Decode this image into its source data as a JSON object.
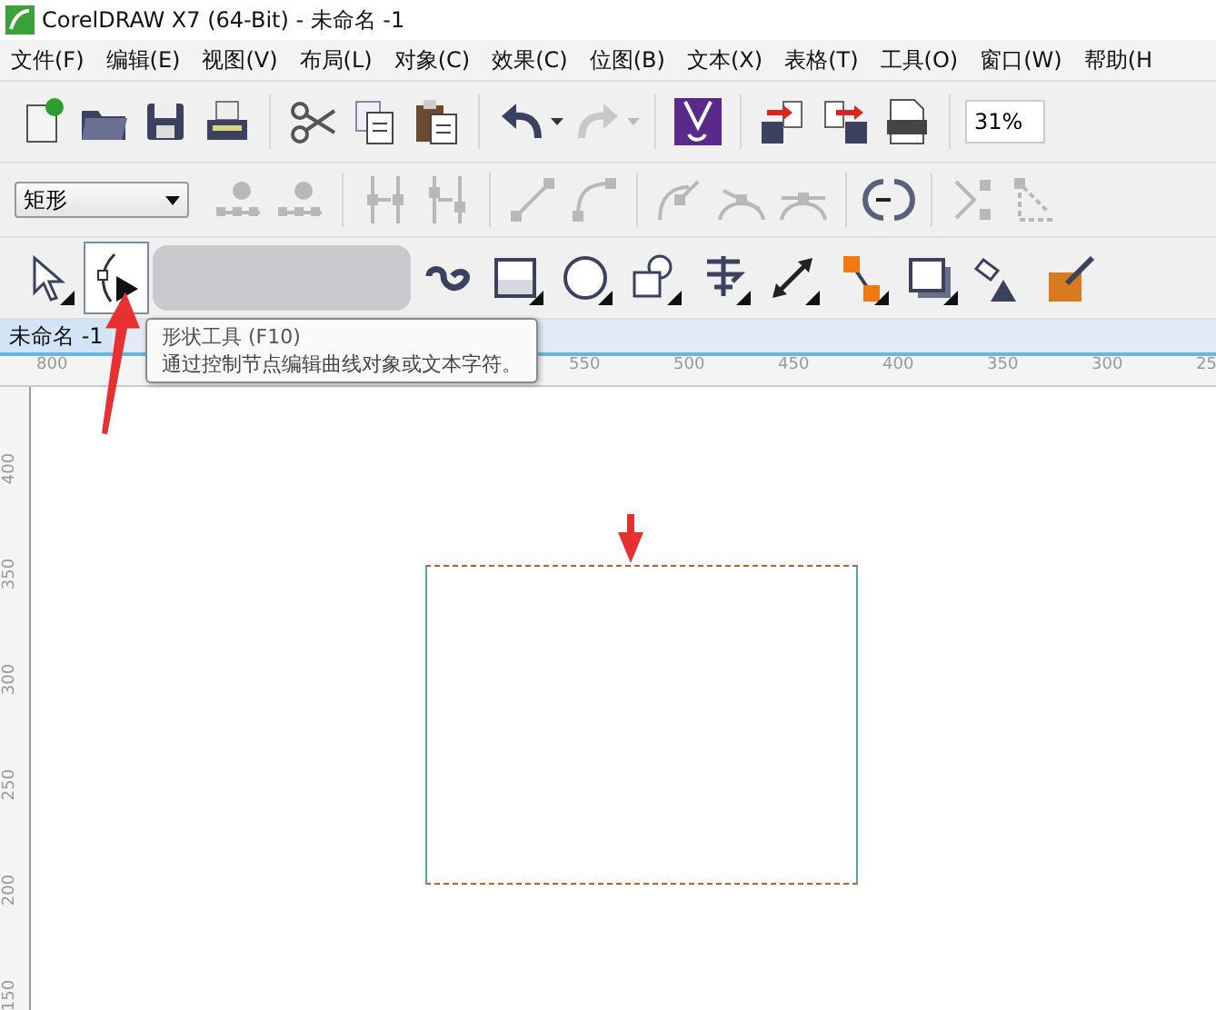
{
  "window": {
    "title": "CorelDRAW X7 (64-Bit) - 未命名 -1"
  },
  "menu": [
    {
      "label": "文件(F)"
    },
    {
      "label": "编辑(E)"
    },
    {
      "label": "视图(V)"
    },
    {
      "label": "布局(L)"
    },
    {
      "label": "对象(C)"
    },
    {
      "label": "效果(C)"
    },
    {
      "label": "位图(B)"
    },
    {
      "label": "文本(X)"
    },
    {
      "label": "表格(T)"
    },
    {
      "label": "工具(O)"
    },
    {
      "label": "窗口(W)"
    },
    {
      "label": "帮助(H"
    }
  ],
  "toolbar": {
    "zoom_value": "31%"
  },
  "property_bar": {
    "shape_select": "矩形"
  },
  "toolbox": {
    "tools": [
      {
        "kind": "pick",
        "selected": false
      },
      {
        "kind": "shape",
        "selected": true
      },
      {
        "kind": "blurred",
        "selected": false
      },
      {
        "kind": "spiral",
        "selected": false
      },
      {
        "kind": "rectangle",
        "selected": false
      },
      {
        "kind": "ellipse",
        "selected": false
      },
      {
        "kind": "polygon",
        "selected": false
      },
      {
        "kind": "text",
        "selected": false
      },
      {
        "kind": "dimension",
        "selected": false
      },
      {
        "kind": "connector",
        "selected": false
      },
      {
        "kind": "shadow",
        "selected": false
      },
      {
        "kind": "fill",
        "selected": false
      },
      {
        "kind": "color",
        "selected": false
      }
    ]
  },
  "document_tab": {
    "label": "未命名 -1"
  },
  "tooltip": {
    "title": "形状工具 (F10)",
    "description": "通过控制节点编辑曲线对象或文本字符。"
  },
  "rulers": {
    "horizontal": [
      "800",
      "550",
      "500",
      "450",
      "400",
      "350",
      "300",
      "25"
    ],
    "vertical": [
      "400",
      "350",
      "300",
      "250",
      "200",
      "150"
    ]
  }
}
